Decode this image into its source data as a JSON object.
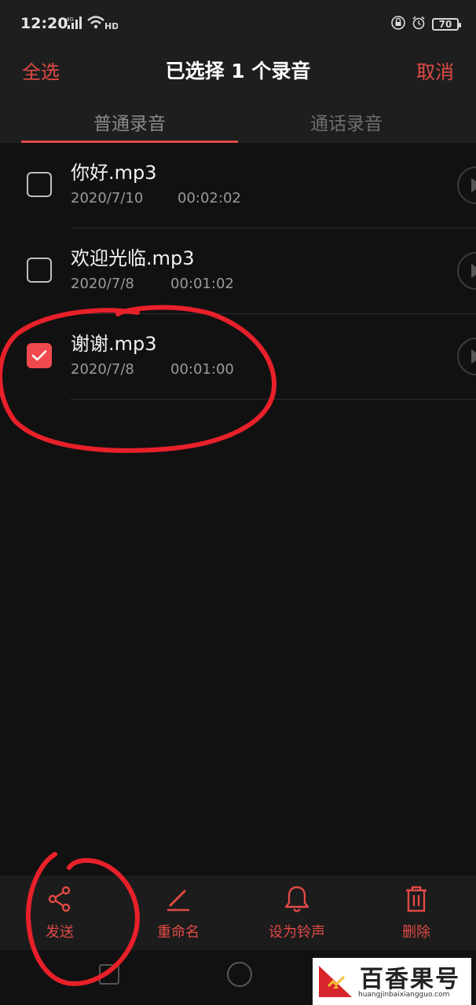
{
  "status_bar": {
    "time": "12:20",
    "network_type": "4G",
    "wifi_label": "HD",
    "battery_level": "70",
    "icons": [
      "signal-icon",
      "wifi-icon",
      "lock-icon",
      "alarm-icon",
      "battery-icon"
    ]
  },
  "header": {
    "select_all": "全选",
    "title": "已选择 1 个录音",
    "cancel": "取消"
  },
  "tabs": [
    {
      "label": "普通录音",
      "active": true
    },
    {
      "label": "通话录音",
      "active": false
    }
  ],
  "recordings": [
    {
      "name": "你好.mp3",
      "date": "2020/7/10",
      "duration": "00:02:02",
      "checked": false
    },
    {
      "name": "欢迎光临.mp3",
      "date": "2020/7/8",
      "duration": "00:01:02",
      "checked": false
    },
    {
      "name": "谢谢.mp3",
      "date": "2020/7/8",
      "duration": "00:01:00",
      "checked": true
    }
  ],
  "toolbar": {
    "share_label": "发送",
    "rename_label": "重命名",
    "ringtone_label": "设为铃声",
    "delete_label": "删除"
  },
  "watermark": {
    "title": "百香果号",
    "url": "huangjinbaixiangguo.com"
  },
  "colors": {
    "accent": "#e04a45",
    "checkbox_checked": "#f04a4e",
    "background": "#111111",
    "panel": "#1e1e1e",
    "annotation": "#e8202a"
  }
}
